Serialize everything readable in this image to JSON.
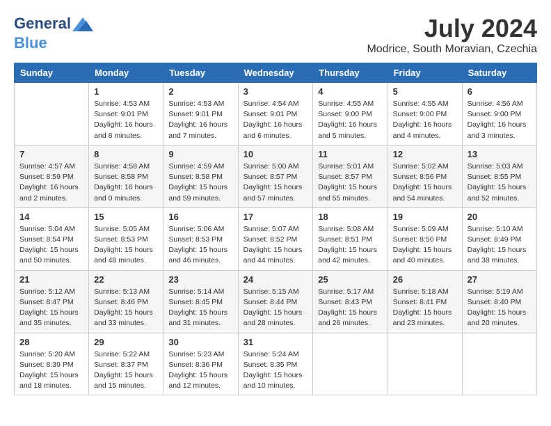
{
  "header": {
    "logo_line1": "General",
    "logo_line2": "Blue",
    "month_year": "July 2024",
    "location": "Modrice, South Moravian, Czechia"
  },
  "columns": [
    "Sunday",
    "Monday",
    "Tuesday",
    "Wednesday",
    "Thursday",
    "Friday",
    "Saturday"
  ],
  "weeks": [
    [
      {
        "day": "",
        "info": ""
      },
      {
        "day": "1",
        "info": "Sunrise: 4:53 AM\nSunset: 9:01 PM\nDaylight: 16 hours\nand 8 minutes."
      },
      {
        "day": "2",
        "info": "Sunrise: 4:53 AM\nSunset: 9:01 PM\nDaylight: 16 hours\nand 7 minutes."
      },
      {
        "day": "3",
        "info": "Sunrise: 4:54 AM\nSunset: 9:01 PM\nDaylight: 16 hours\nand 6 minutes."
      },
      {
        "day": "4",
        "info": "Sunrise: 4:55 AM\nSunset: 9:00 PM\nDaylight: 16 hours\nand 5 minutes."
      },
      {
        "day": "5",
        "info": "Sunrise: 4:55 AM\nSunset: 9:00 PM\nDaylight: 16 hours\nand 4 minutes."
      },
      {
        "day": "6",
        "info": "Sunrise: 4:56 AM\nSunset: 9:00 PM\nDaylight: 16 hours\nand 3 minutes."
      }
    ],
    [
      {
        "day": "7",
        "info": "Sunrise: 4:57 AM\nSunset: 8:59 PM\nDaylight: 16 hours\nand 2 minutes."
      },
      {
        "day": "8",
        "info": "Sunrise: 4:58 AM\nSunset: 8:58 PM\nDaylight: 16 hours\nand 0 minutes."
      },
      {
        "day": "9",
        "info": "Sunrise: 4:59 AM\nSunset: 8:58 PM\nDaylight: 15 hours\nand 59 minutes."
      },
      {
        "day": "10",
        "info": "Sunrise: 5:00 AM\nSunset: 8:57 PM\nDaylight: 15 hours\nand 57 minutes."
      },
      {
        "day": "11",
        "info": "Sunrise: 5:01 AM\nSunset: 8:57 PM\nDaylight: 15 hours\nand 55 minutes."
      },
      {
        "day": "12",
        "info": "Sunrise: 5:02 AM\nSunset: 8:56 PM\nDaylight: 15 hours\nand 54 minutes."
      },
      {
        "day": "13",
        "info": "Sunrise: 5:03 AM\nSunset: 8:55 PM\nDaylight: 15 hours\nand 52 minutes."
      }
    ],
    [
      {
        "day": "14",
        "info": "Sunrise: 5:04 AM\nSunset: 8:54 PM\nDaylight: 15 hours\nand 50 minutes."
      },
      {
        "day": "15",
        "info": "Sunrise: 5:05 AM\nSunset: 8:53 PM\nDaylight: 15 hours\nand 48 minutes."
      },
      {
        "day": "16",
        "info": "Sunrise: 5:06 AM\nSunset: 8:53 PM\nDaylight: 15 hours\nand 46 minutes."
      },
      {
        "day": "17",
        "info": "Sunrise: 5:07 AM\nSunset: 8:52 PM\nDaylight: 15 hours\nand 44 minutes."
      },
      {
        "day": "18",
        "info": "Sunrise: 5:08 AM\nSunset: 8:51 PM\nDaylight: 15 hours\nand 42 minutes."
      },
      {
        "day": "19",
        "info": "Sunrise: 5:09 AM\nSunset: 8:50 PM\nDaylight: 15 hours\nand 40 minutes."
      },
      {
        "day": "20",
        "info": "Sunrise: 5:10 AM\nSunset: 8:49 PM\nDaylight: 15 hours\nand 38 minutes."
      }
    ],
    [
      {
        "day": "21",
        "info": "Sunrise: 5:12 AM\nSunset: 8:47 PM\nDaylight: 15 hours\nand 35 minutes."
      },
      {
        "day": "22",
        "info": "Sunrise: 5:13 AM\nSunset: 8:46 PM\nDaylight: 15 hours\nand 33 minutes."
      },
      {
        "day": "23",
        "info": "Sunrise: 5:14 AM\nSunset: 8:45 PM\nDaylight: 15 hours\nand 31 minutes."
      },
      {
        "day": "24",
        "info": "Sunrise: 5:15 AM\nSunset: 8:44 PM\nDaylight: 15 hours\nand 28 minutes."
      },
      {
        "day": "25",
        "info": "Sunrise: 5:17 AM\nSunset: 8:43 PM\nDaylight: 15 hours\nand 26 minutes."
      },
      {
        "day": "26",
        "info": "Sunrise: 5:18 AM\nSunset: 8:41 PM\nDaylight: 15 hours\nand 23 minutes."
      },
      {
        "day": "27",
        "info": "Sunrise: 5:19 AM\nSunset: 8:40 PM\nDaylight: 15 hours\nand 20 minutes."
      }
    ],
    [
      {
        "day": "28",
        "info": "Sunrise: 5:20 AM\nSunset: 8:39 PM\nDaylight: 15 hours\nand 18 minutes."
      },
      {
        "day": "29",
        "info": "Sunrise: 5:22 AM\nSunset: 8:37 PM\nDaylight: 15 hours\nand 15 minutes."
      },
      {
        "day": "30",
        "info": "Sunrise: 5:23 AM\nSunset: 8:36 PM\nDaylight: 15 hours\nand 12 minutes."
      },
      {
        "day": "31",
        "info": "Sunrise: 5:24 AM\nSunset: 8:35 PM\nDaylight: 15 hours\nand 10 minutes."
      },
      {
        "day": "",
        "info": ""
      },
      {
        "day": "",
        "info": ""
      },
      {
        "day": "",
        "info": ""
      }
    ]
  ]
}
